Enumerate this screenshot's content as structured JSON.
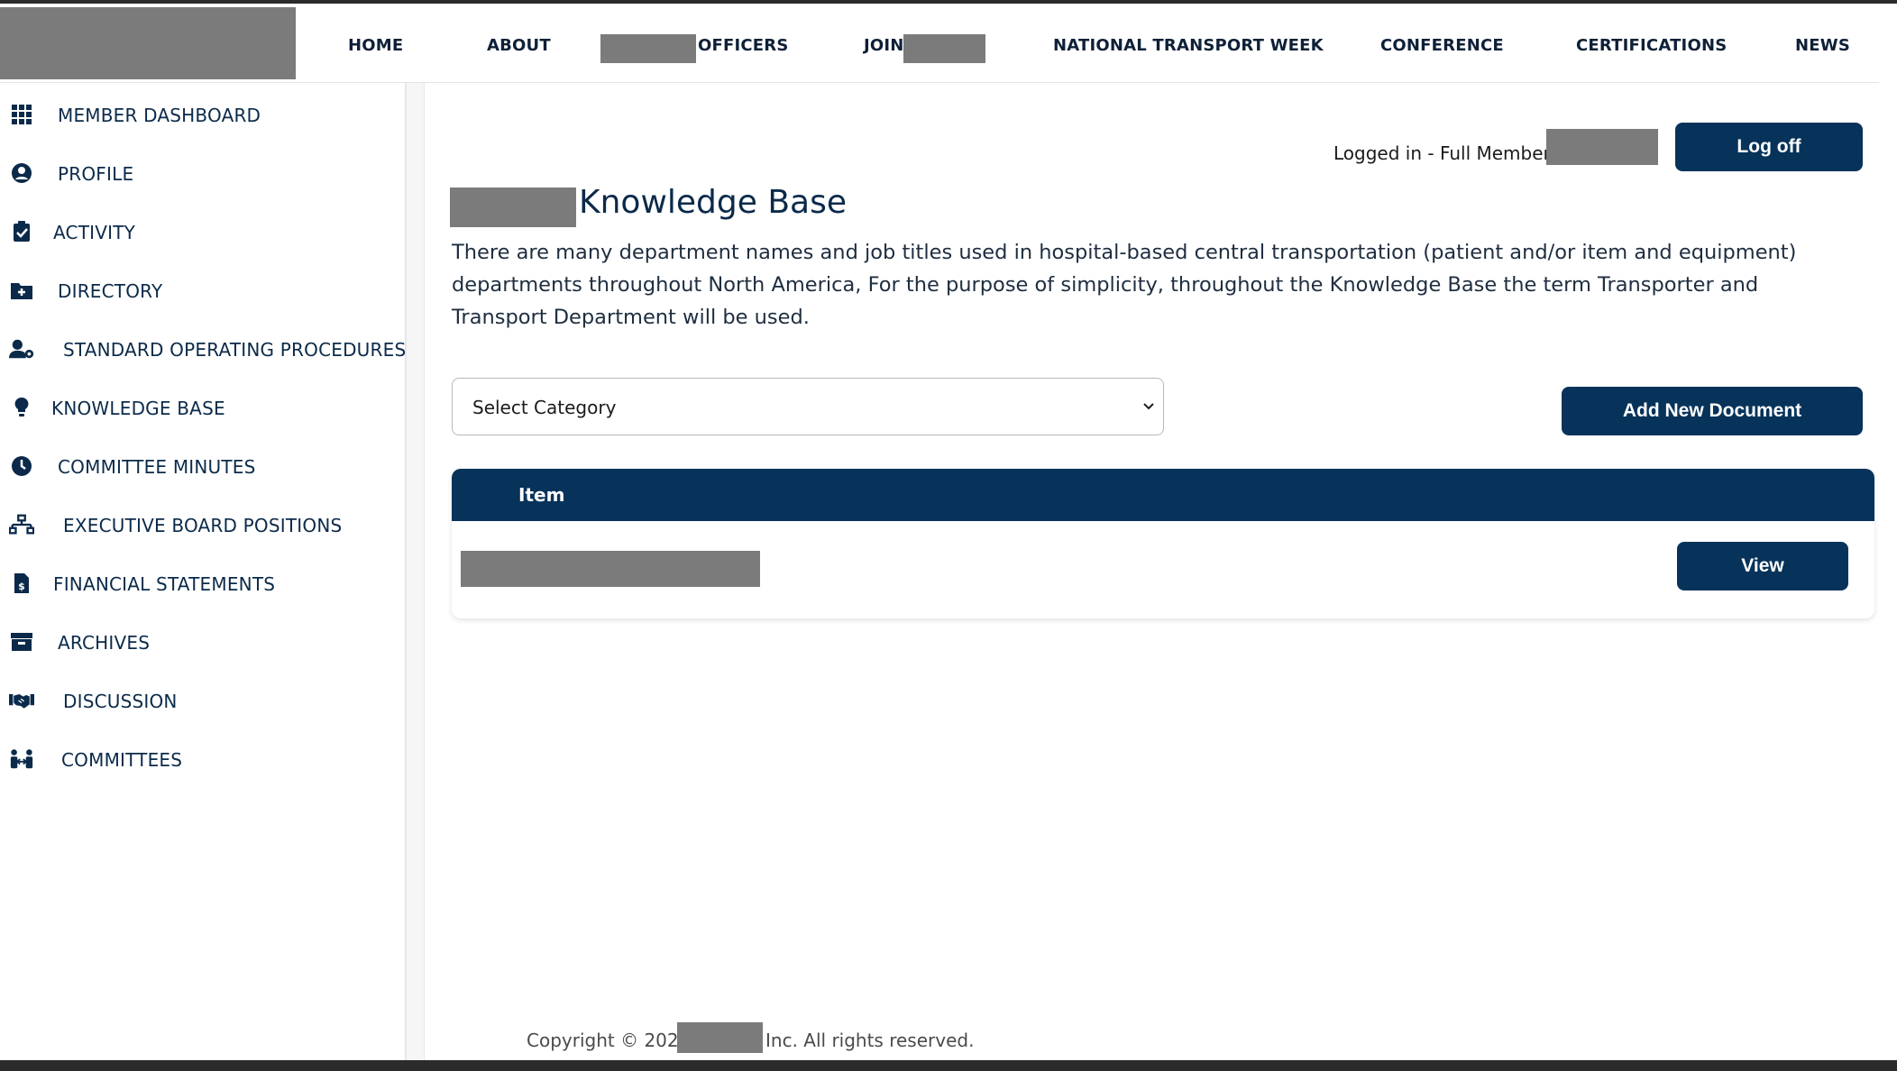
{
  "header": {
    "nav": [
      {
        "label": "HOME"
      },
      {
        "label": "ABOUT"
      },
      {
        "label": "OFFICERS"
      },
      {
        "label": "JOIN"
      },
      {
        "label": "NATIONAL TRANSPORT WEEK"
      },
      {
        "label": "CONFERENCE"
      },
      {
        "label": "CERTIFICATIONS"
      },
      {
        "label": "NEWS"
      }
    ]
  },
  "sidebar": {
    "items": [
      {
        "label": "MEMBER DASHBOARD",
        "icon": "grid-icon"
      },
      {
        "label": "PROFILE",
        "icon": "user-circle-icon"
      },
      {
        "label": "ACTIVITY",
        "icon": "clipboard-check-icon"
      },
      {
        "label": "DIRECTORY",
        "icon": "folder-plus-icon"
      },
      {
        "label": "STANDARD OPERATING PROCEDURES",
        "icon": "user-gear-icon"
      },
      {
        "label": "KNOWLEDGE BASE",
        "icon": "lightbulb-icon"
      },
      {
        "label": "COMMITTEE MINUTES",
        "icon": "clock-icon"
      },
      {
        "label": "EXECUTIVE BOARD POSITIONS",
        "icon": "sitemap-icon"
      },
      {
        "label": "FINANCIAL STATEMENTS",
        "icon": "file-invoice-dollar-icon"
      },
      {
        "label": "ARCHIVES",
        "icon": "archive-box-icon"
      },
      {
        "label": "DISCUSSION",
        "icon": "handshake-icon"
      },
      {
        "label": "COMMITTEES",
        "icon": "people-arrows-icon"
      }
    ]
  },
  "main": {
    "login_status": "Logged in - Full Member",
    "logoff_label": "Log off",
    "title": "Knowledge Base",
    "description": "There are many department names and job titles used in hospital-based central transportation (patient and/or item and equipment) departments throughout North America, For the purpose of simplicity, throughout the Knowledge Base the term Transporter and Transport Department will be used.",
    "category_select": {
      "selected": "Select Category"
    },
    "add_document_label": "Add New Document",
    "table": {
      "header_item": "Item",
      "rows": [
        {
          "view_label": "View"
        }
      ]
    }
  },
  "footer": {
    "copyright": "Copyright © 2025",
    "copyright_suffix": "Inc. All rights reserved."
  },
  "colors": {
    "primary": "#07335a",
    "text": "#0b2a4a",
    "redaction": "#7b7b7b"
  }
}
